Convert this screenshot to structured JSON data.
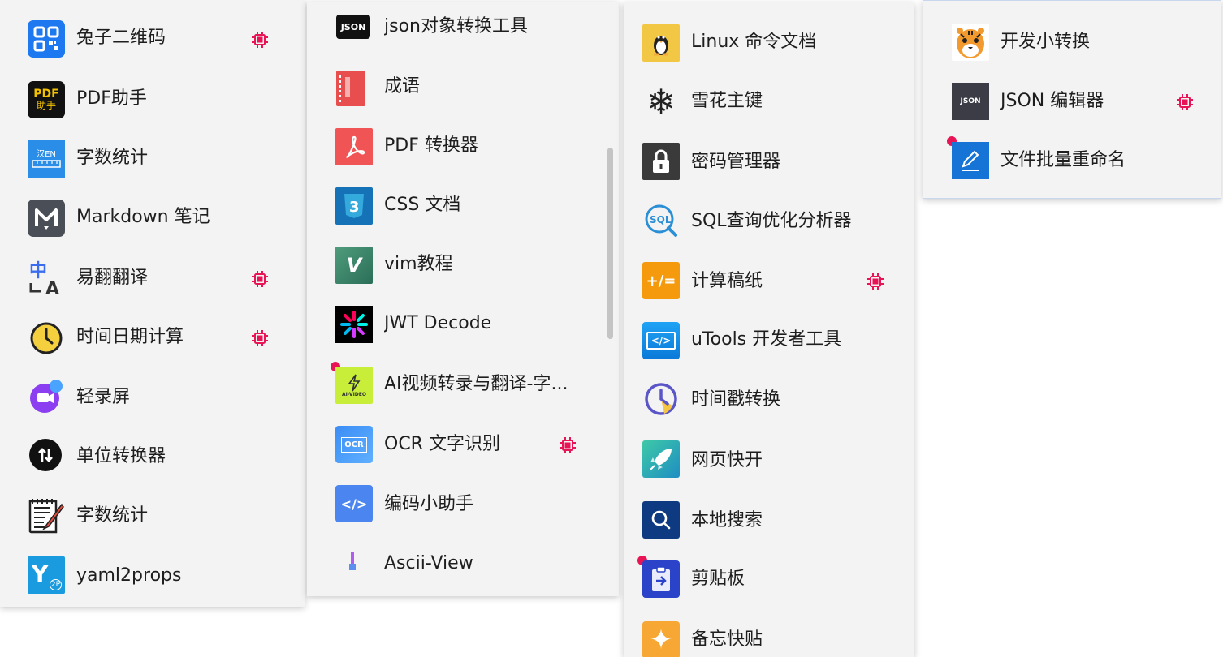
{
  "panel1": {
    "items": [
      {
        "label": "兔子二维码",
        "icon": "qr-code-icon",
        "chip": true
      },
      {
        "label": "PDF助手",
        "icon": "pdf-helper-icon",
        "icon_text": "PDF",
        "icon_text2": "助手",
        "chip": false
      },
      {
        "label": "字数统计",
        "icon": "ruler-icon",
        "icon_text": "汉EN",
        "chip": false
      },
      {
        "label": "Markdown 笔记",
        "icon": "markdown-icon",
        "icon_text": "M",
        "chip": false
      },
      {
        "label": "易翻翻译",
        "icon": "translate-icon",
        "icon_text": "中",
        "icon_text2": "A",
        "chip": true
      },
      {
        "label": "时间日期计算",
        "icon": "clock-icon",
        "chip": true
      },
      {
        "label": "轻录屏",
        "icon": "screen-record-icon",
        "chip": false
      },
      {
        "label": "单位转换器",
        "icon": "unit-convert-icon",
        "chip": false
      },
      {
        "label": "字数统计",
        "icon": "notepad-icon",
        "chip": false
      },
      {
        "label": "yaml2props",
        "icon": "yaml-icon",
        "icon_text": "Y",
        "icon_text2": "2P",
        "chip": false
      }
    ]
  },
  "panel2": {
    "items": [
      {
        "label": "json对象转换工具",
        "icon": "json-badge-icon",
        "icon_text": "JSON",
        "chip": false,
        "dot": false
      },
      {
        "label": "成语",
        "icon": "book-icon",
        "chip": false,
        "dot": false
      },
      {
        "label": "PDF 转换器",
        "icon": "acrobat-icon",
        "chip": false,
        "dot": false
      },
      {
        "label": "CSS 文档",
        "icon": "css3-icon",
        "icon_text": "3",
        "chip": false,
        "dot": false
      },
      {
        "label": "vim教程",
        "icon": "vim-icon",
        "icon_text": "V",
        "chip": false,
        "dot": false
      },
      {
        "label": "JWT Decode",
        "icon": "jwt-icon",
        "chip": false,
        "dot": false
      },
      {
        "label": "AI视频转录与翻译-字...",
        "icon": "ai-video-icon",
        "icon_text": "AI-VIDEO",
        "chip": false,
        "dot": true
      },
      {
        "label": "OCR 文字识别",
        "icon": "ocr-icon",
        "icon_text": "OCR",
        "chip": true,
        "dot": false
      },
      {
        "label": "编码小助手",
        "icon": "code-icon",
        "icon_text": "</>",
        "chip": false,
        "dot": false
      },
      {
        "label": "Ascii-View",
        "icon": "ascii-icon",
        "chip": false,
        "dot": false
      }
    ]
  },
  "panel3": {
    "items": [
      {
        "label": "Linux 命令文档",
        "icon": "linux-icon",
        "chip": false,
        "dot": false
      },
      {
        "label": "雪花主键",
        "icon": "snowflake-icon",
        "icon_text": "❄",
        "chip": false,
        "dot": false
      },
      {
        "label": "密码管理器",
        "icon": "lock-icon",
        "chip": false,
        "dot": false
      },
      {
        "label": "SQL查询优化分析器",
        "icon": "sql-icon",
        "icon_text": "SQL",
        "chip": false,
        "dot": false
      },
      {
        "label": "计算稿纸",
        "icon": "calculator-icon",
        "icon_text": "+/=",
        "chip": true,
        "dot": false
      },
      {
        "label": "uTools 开发者工具",
        "icon": "devtools-icon",
        "icon_text": "</>",
        "chip": false,
        "dot": false
      },
      {
        "label": "时间戳转换",
        "icon": "timestamp-icon",
        "chip": false,
        "dot": false
      },
      {
        "label": "网页快开",
        "icon": "rocket-icon",
        "chip": false,
        "dot": false
      },
      {
        "label": "本地搜索",
        "icon": "search-icon",
        "chip": false,
        "dot": false
      },
      {
        "label": "剪贴板",
        "icon": "clipboard-icon",
        "chip": false,
        "dot": true
      },
      {
        "label": "备忘快贴",
        "icon": "star-note-icon",
        "icon_text": "✦",
        "chip": false,
        "dot": false
      }
    ]
  },
  "panel4": {
    "items": [
      {
        "label": "开发小转换",
        "icon": "tiger-icon",
        "chip": false,
        "dot": false
      },
      {
        "label": "JSON 编辑器",
        "icon": "json-editor-icon",
        "icon_text": "JSON",
        "chip": true,
        "dot": false
      },
      {
        "label": "文件批量重命名",
        "icon": "pencil-icon",
        "chip": false,
        "dot": true
      }
    ]
  },
  "colors": {
    "chip": "#e91455",
    "dot": "#e91455",
    "panel_bg": "#f3f3f3"
  }
}
